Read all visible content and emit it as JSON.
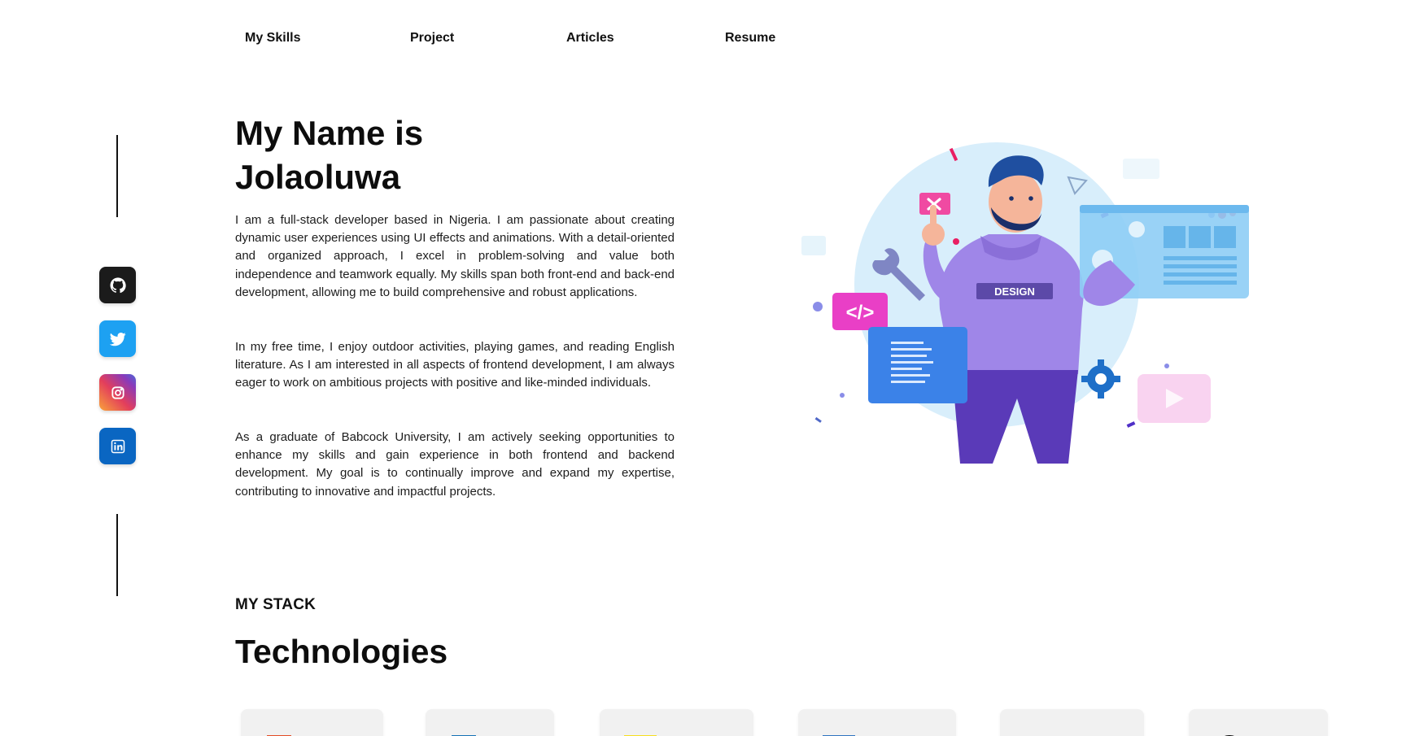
{
  "nav": {
    "items": [
      {
        "label": "My Skills"
      },
      {
        "label": "Project"
      },
      {
        "label": "Articles"
      },
      {
        "label": "Resume"
      }
    ]
  },
  "social": [
    {
      "name": "github-icon",
      "color": "#1b1b1b"
    },
    {
      "name": "twitter-icon",
      "color": "#1da1f2"
    },
    {
      "name": "instagram-icon",
      "color": "#c13584"
    },
    {
      "name": "linkedin-icon",
      "color": "#0a66c2"
    }
  ],
  "hero": {
    "title_line1": "My Name is",
    "title_line2": "Jolaoluwa",
    "paragraphs": [
      "I am a full-stack developer based in Nigeria. I am passionate about creating dynamic user experiences using UI effects and animations. With a detail-oriented and organized approach, I excel in problem-solving and value both independence and teamwork equally. My skills span both front-end and back-end development, allowing me to build comprehensive and robust applications.",
      "In my free time, I enjoy outdoor activities, playing games, and reading English literature. As I am interested in all aspects of frontend development, I am always eager to work on ambitious projects with positive and like-minded individuals.",
      "As a graduate of Babcock University, I am actively seeking opportunities to enhance my skills and gain experience in both frontend and backend development. My goal is to continually improve and expand my expertise, contributing to innovative and impactful projects."
    ],
    "illustration_badge": "DESIGN"
  },
  "stack": {
    "label": "MY STACK",
    "heading": "Technologies"
  },
  "technologies": [
    {
      "name": "html-icon",
      "color": "#e44d26"
    },
    {
      "name": "css-icon",
      "color": "#1572b6"
    },
    {
      "name": "javascript-icon",
      "color": "#f7df1e"
    },
    {
      "name": "typescript-icon",
      "color": "#2f74c0"
    },
    {
      "name": "tailwind-icon",
      "color": "#38bdf8"
    },
    {
      "name": "nextjs-icon",
      "color": "#000000"
    }
  ]
}
